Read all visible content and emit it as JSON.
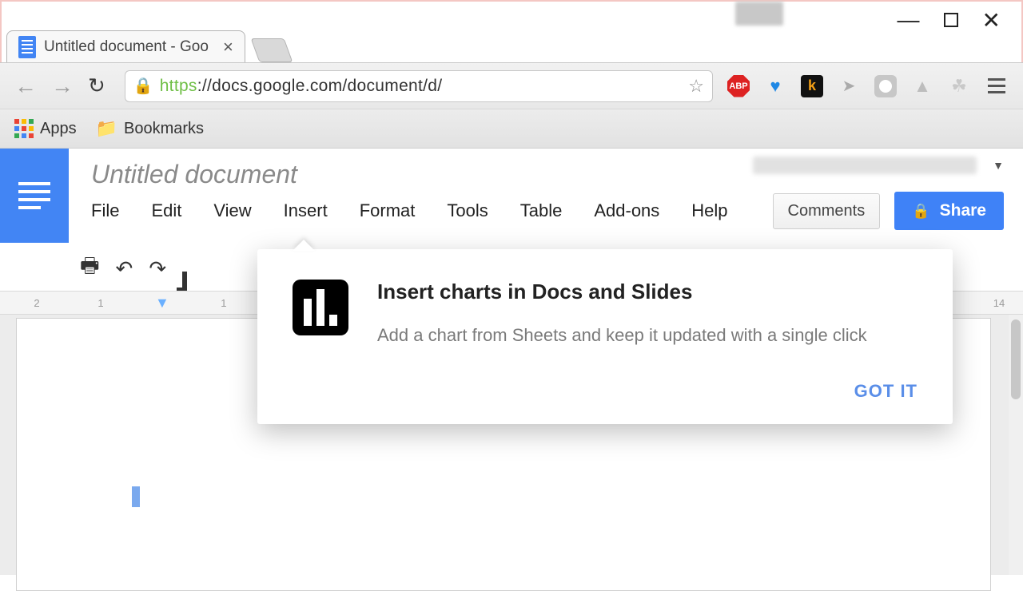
{
  "window": {
    "tab_title": "Untitled document - Goo",
    "url_protocol": "https",
    "url_host": "://docs.google.com",
    "url_path": "/document/d/"
  },
  "bookmarks_bar": {
    "apps_label": "Apps",
    "bookmarks_label": "Bookmarks"
  },
  "docs": {
    "title": "Untitled document",
    "menus": {
      "file": "File",
      "edit": "Edit",
      "view": "View",
      "insert": "Insert",
      "format": "Format",
      "tools": "Tools",
      "table": "Table",
      "addons": "Add-ons",
      "help": "Help"
    },
    "comments_label": "Comments",
    "share_label": "Share",
    "ruler": {
      "m2": "2",
      "m1": "1",
      "p1": "1",
      "p14": "14"
    }
  },
  "popover": {
    "title": "Insert charts in Docs and Slides",
    "body": "Add a chart from Sheets and keep it updated with a single click",
    "action": "GOT IT"
  }
}
